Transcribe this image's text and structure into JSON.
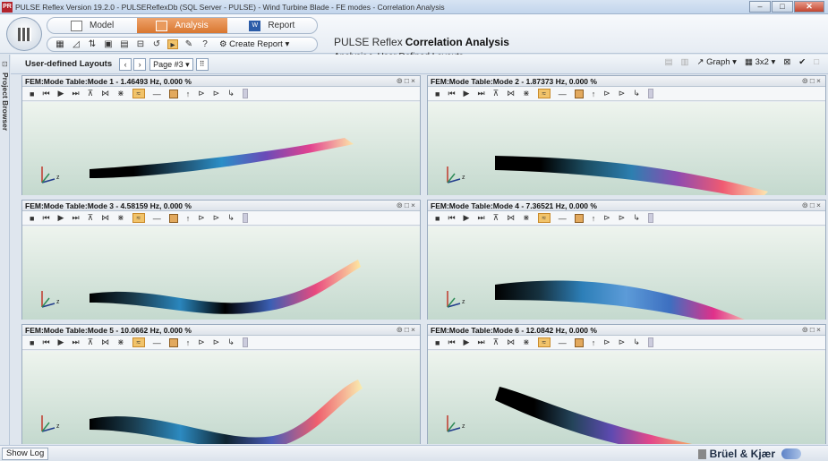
{
  "window": {
    "app_icon": "PR",
    "title": "PULSE Reflex Version 19.2.0 - PULSEReflexDb (SQL Server - PULSE) - Wind Turbine Blade - FE modes - Correlation Analysis"
  },
  "ribbon": {
    "tabs": [
      {
        "label": "Model",
        "icon": "model-icon"
      },
      {
        "label": "Analysis",
        "icon": "analysis-icon",
        "active": true
      },
      {
        "label": "Report",
        "icon": "word-icon"
      }
    ],
    "create_report": "Create Report",
    "product": "PULSE Reflex",
    "page_title": "Correlation Analysis",
    "breadcrumb": "Analysis > User Defined Layouts"
  },
  "sidebar": {
    "label": "Project Browser"
  },
  "layout_bar": {
    "title": "User-defined Layouts",
    "page": "Page #3",
    "graph": "Graph",
    "grid": "3x2"
  },
  "panels": [
    {
      "title": "FEM:Mode Table:Mode 1 - 1.46493 Hz, 0.000 %"
    },
    {
      "title": "FEM:Mode Table:Mode 2 - 1.87373 Hz, 0.000 %"
    },
    {
      "title": "FEM:Mode Table:Mode 3 - 4.58159 Hz, 0.000 %"
    },
    {
      "title": "FEM:Mode Table:Mode 4 - 7.36521 Hz, 0.000 %"
    },
    {
      "title": "FEM:Mode Table:Mode 5 - 10.0662 Hz, 0.000 %"
    },
    {
      "title": "FEM:Mode Table:Mode 6 - 12.0842 Hz, 0.000 %"
    }
  ],
  "colors": {
    "accent": "#d9762f",
    "view_top": "#eef4ee",
    "view_bottom": "#c4d9ce"
  },
  "status": {
    "show_log": "Show Log",
    "brand": "Brüel & Kjær"
  }
}
